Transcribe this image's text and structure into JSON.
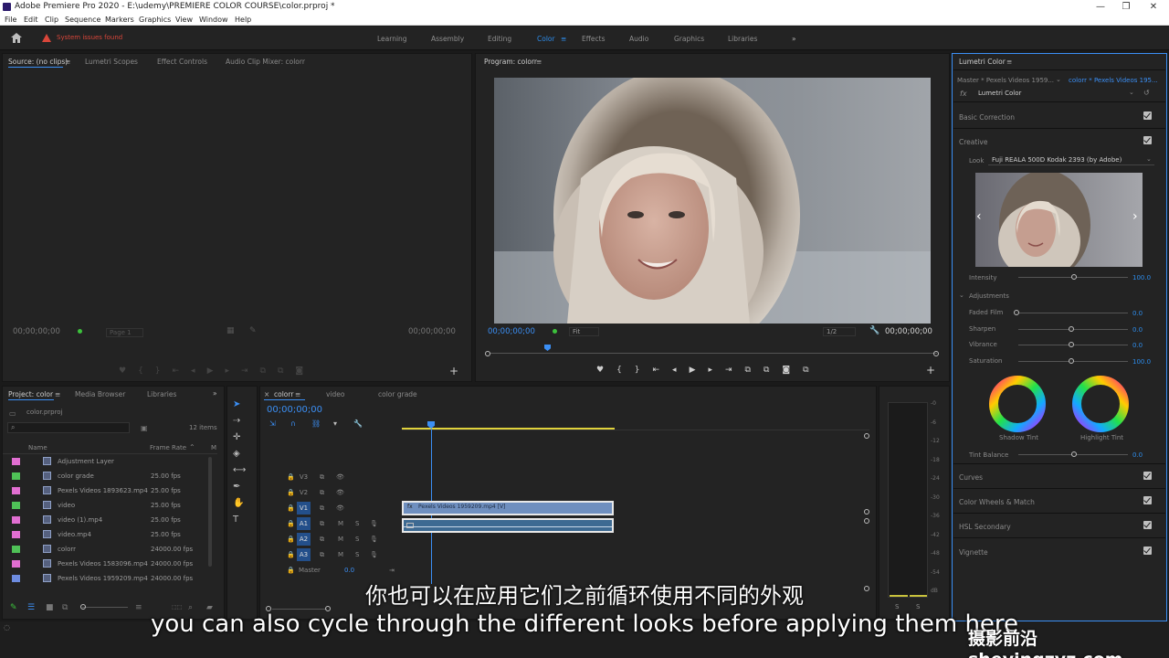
{
  "window": {
    "title": "Adobe Premiere Pro 2020 - E:\\udemy\\PREMIERE COLOR COURSE\\color.prproj *",
    "controls": [
      "—",
      "❐",
      "✕"
    ]
  },
  "menu": [
    "File",
    "Edit",
    "Clip",
    "Sequence",
    "Markers",
    "Graphics",
    "View",
    "Window",
    "Help"
  ],
  "workspace": {
    "warning": "System issues found",
    "tabs": [
      "Learning",
      "Assembly",
      "Editing",
      "Color",
      "Effects",
      "Audio",
      "Graphics",
      "Libraries"
    ],
    "active": "Color",
    "more": "»"
  },
  "source_panel": {
    "tabs": [
      "Source: (no clips)",
      "Lumetri Scopes",
      "Effect Controls",
      "Audio Clip Mixer: colorr"
    ],
    "timecode_left": "00;00;00;00",
    "timecode_right": "00;00;00;00",
    "page": "Page 1"
  },
  "program_panel": {
    "title": "Program: colorr",
    "timecode_left": "00;00;00;00",
    "fit": "Fit",
    "ratio": "1/2",
    "timecode_right": "00;00;00;00"
  },
  "project_panel": {
    "tabs": [
      "Project: color",
      "Media Browser",
      "Libraries"
    ],
    "project_file": "color.prproj",
    "items_count": "12 items",
    "col_name": "Name",
    "col_framerate": "Frame Rate",
    "rows": [
      {
        "name": "Adjustment Layer",
        "rate": "",
        "color": "#e16ed1"
      },
      {
        "name": "color grade",
        "rate": "25.00 fps",
        "color": "#4fc257"
      },
      {
        "name": "Pexels Videos 1893623.mp4",
        "rate": "25.00 fps",
        "color": "#e16ed1"
      },
      {
        "name": "video",
        "rate": "25.00 fps",
        "color": "#4fc257"
      },
      {
        "name": "video (1).mp4",
        "rate": "25.00 fps",
        "color": "#e16ed1"
      },
      {
        "name": "video.mp4",
        "rate": "25.00 fps",
        "color": "#e16ed1"
      },
      {
        "name": "colorr",
        "rate": "24000.00 fps",
        "color": "#4fc257"
      },
      {
        "name": "Pexels Videos 1583096.mp4",
        "rate": "24000.00 fps",
        "color": "#e16ed1"
      },
      {
        "name": "Pexels Videos 1959209.mp4",
        "rate": "24000.00 fps",
        "color": "#6d8ce0"
      }
    ]
  },
  "timeline": {
    "tabs": [
      "colorr",
      "video",
      "color grade"
    ],
    "timecode": "00;00;00;00",
    "tracks": [
      "V3",
      "V2",
      "V1",
      "A1",
      "A2",
      "A3"
    ],
    "master": "Master",
    "master_value": "0.0",
    "clip_label": "Pexels Videos 1959209.mp4 [V]",
    "meter_ticks": [
      "-0",
      "-6",
      "-12",
      "-18",
      "-24",
      "-30",
      "-36",
      "-42",
      "-48",
      "-54",
      "dB"
    ],
    "meter_solo": [
      "S",
      "S"
    ]
  },
  "lumetri": {
    "title": "Lumetri Color",
    "master_clip": "Master * Pexels Videos 1959...",
    "seq_clip": "colorr * Pexels Videos 195...",
    "effect": "Lumetri Color",
    "sections": [
      "Basic Correction",
      "Creative"
    ],
    "look_label": "Look",
    "look_value": "Fuji REALA 500D Kodak 2393 (by Adobe)",
    "intensity_label": "Intensity",
    "intensity_value": "100.0",
    "adjustments": "Adjustments",
    "sliders": [
      {
        "label": "Faded Film",
        "value": "0.0",
        "level": 0
      },
      {
        "label": "Sharpen",
        "value": "0.0",
        "level": 0.5
      },
      {
        "label": "Vibrance",
        "value": "0.0",
        "level": 0.5
      },
      {
        "label": "Saturation",
        "value": "100.0",
        "level": 0.5
      }
    ],
    "shadow_tint": "Shadow Tint",
    "highlight_tint": "Highlight Tint",
    "tint_balance": "Tint Balance",
    "tint_balance_value": "0.0",
    "bottom_sections": [
      "Curves",
      "Color Wheels & Match",
      "HSL Secondary",
      "Vignette"
    ]
  },
  "subtitles": {
    "chinese": "你也可以在应用它们之前循环使用不同的外观",
    "english": "you can also cycle through the different looks before applying them here"
  },
  "watermark": "摄影前沿 sheyingzyz.com"
}
